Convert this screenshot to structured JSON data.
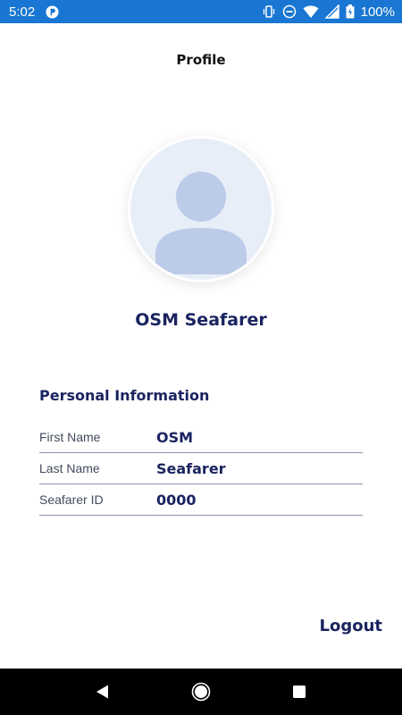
{
  "status_bar": {
    "time": "5:02",
    "battery_percent": "100%",
    "icons": [
      "app-notification-icon",
      "vibrate-icon",
      "do-not-disturb-icon",
      "wifi-icon",
      "signal-icon",
      "battery-icon"
    ],
    "background_color": "#1976d2"
  },
  "header": {
    "title": "Profile"
  },
  "profile": {
    "name": "OSM Seafarer",
    "avatar_icon": "person-placeholder-icon"
  },
  "personal_info": {
    "title": "Personal Information",
    "rows": [
      {
        "label": "First Name",
        "value": "OSM"
      },
      {
        "label": "Last Name",
        "value": "Seafarer"
      },
      {
        "label": "Seafarer ID",
        "value": "0000"
      }
    ]
  },
  "actions": {
    "logout_label": "Logout"
  },
  "nav_bar": {
    "icons": [
      "back-icon",
      "home-icon",
      "recents-icon"
    ]
  },
  "colors": {
    "primary_text": "#1a2460",
    "avatar_bg": "#e8eef8",
    "avatar_figure": "#bccbe8"
  }
}
